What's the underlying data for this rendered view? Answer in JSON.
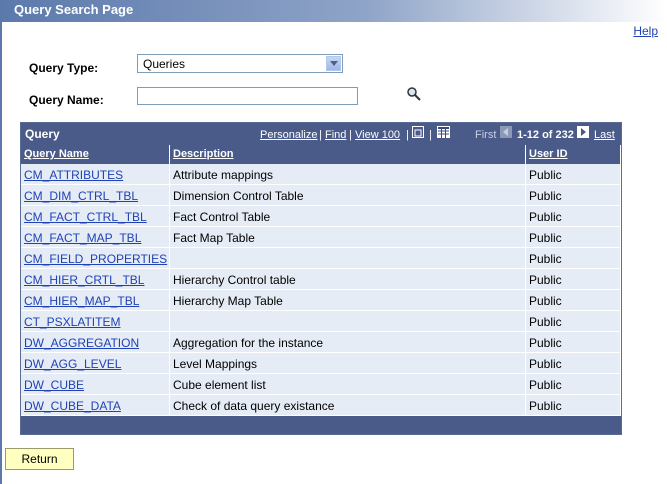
{
  "page": {
    "title": "Query Search Page",
    "help_label": "Help"
  },
  "form": {
    "query_type_label": "Query Type:",
    "query_type_value": "Queries",
    "query_name_label": "Query Name:",
    "query_name_value": ""
  },
  "grid": {
    "title": "Query",
    "personalize": "Personalize",
    "find": "Find",
    "view100": "View 100",
    "sep": "|",
    "first": "First",
    "range": "1-12 of 232",
    "last": "Last",
    "columns": [
      "Query Name",
      "Description",
      "User ID"
    ],
    "rows": [
      {
        "name": "CM_ATTRIBUTES",
        "desc": "Attribute mappings",
        "user": "Public"
      },
      {
        "name": "CM_DIM_CTRL_TBL",
        "desc": "Dimension Control Table",
        "user": "Public"
      },
      {
        "name": "CM_FACT_CTRL_TBL",
        "desc": "Fact Control Table",
        "user": "Public"
      },
      {
        "name": "CM_FACT_MAP_TBL",
        "desc": "Fact Map Table",
        "user": "Public"
      },
      {
        "name": "CM_FIELD_PROPERTIES",
        "desc": "",
        "user": "Public"
      },
      {
        "name": "CM_HIER_CRTL_TBL",
        "desc": "Hierarchy Control table",
        "user": "Public"
      },
      {
        "name": "CM_HIER_MAP_TBL",
        "desc": "Hierarchy Map Table",
        "user": "Public"
      },
      {
        "name": "CT_PSXLATITEM",
        "desc": "",
        "user": "Public"
      },
      {
        "name": "DW_AGGREGATION",
        "desc": "Aggregation for the instance",
        "user": "Public"
      },
      {
        "name": "DW_AGG_LEVEL",
        "desc": "Level Mappings",
        "user": "Public"
      },
      {
        "name": "DW_CUBE",
        "desc": "Cube element list",
        "user": "Public"
      },
      {
        "name": "DW_CUBE_DATA",
        "desc": "Check of data query existance",
        "user": "Public"
      }
    ]
  },
  "buttons": {
    "return": "Return"
  },
  "colors": {
    "header": "#4a5b89",
    "row": "#e6ecf6",
    "link": "#1f42b5",
    "button": "#ffffbf"
  },
  "icons": [
    "lookup-icon",
    "zoom-icon",
    "download-icon",
    "prev-icon",
    "next-icon",
    "dropdown-arrow-icon"
  ]
}
